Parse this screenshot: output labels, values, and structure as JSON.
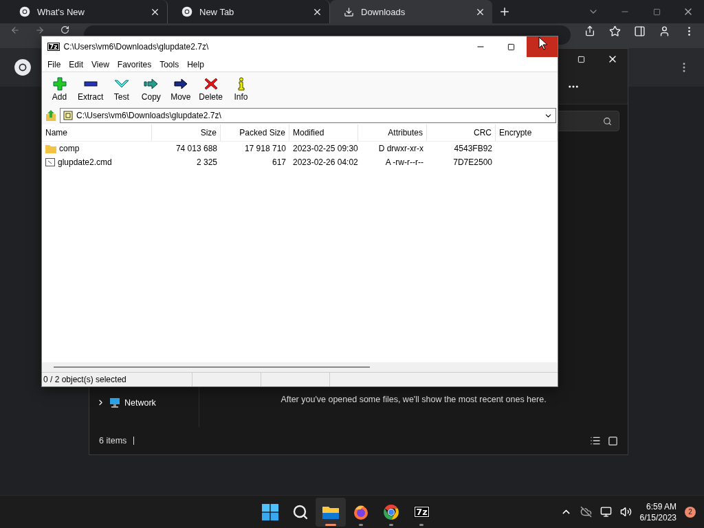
{
  "browser": {
    "tabs": [
      {
        "title": "What's New",
        "kind": "page",
        "selected": false
      },
      {
        "title": "New Tab",
        "kind": "page",
        "selected": false
      },
      {
        "title": "Downloads",
        "kind": "downloads",
        "selected": true
      }
    ]
  },
  "explorer": {
    "nav_items": [
      {
        "label": "Network",
        "expanded": false
      }
    ],
    "message": "After you've opened some files, we'll show the most recent ones here.",
    "status": "6 items"
  },
  "archive_window": {
    "icon_text": "7z",
    "title": "C:\\Users\\vm6\\Downloads\\glupdate2.7z\\",
    "menu": [
      "File",
      "Edit",
      "View",
      "Favorites",
      "Tools",
      "Help"
    ],
    "toolbar": [
      {
        "label": "Add",
        "kind": "add"
      },
      {
        "label": "Extract",
        "kind": "extract"
      },
      {
        "label": "Test",
        "kind": "test"
      },
      {
        "label": "Copy",
        "kind": "copy"
      },
      {
        "label": "Move",
        "kind": "move"
      },
      {
        "label": "Delete",
        "kind": "delete"
      },
      {
        "label": "Info",
        "kind": "info"
      }
    ],
    "path": "C:\\Users\\vm6\\Downloads\\glupdate2.7z\\",
    "columns": [
      "Name",
      "Size",
      "Packed Size",
      "Modified",
      "Attributes",
      "CRC",
      "Encrypte"
    ],
    "rows": [
      {
        "kind": "folder",
        "cells": [
          "comp",
          "74 013 688",
          "17 918 710",
          "2023-02-25 09:30",
          "D drwxr-xr-x",
          "4543FB92"
        ]
      },
      {
        "kind": "file",
        "cells": [
          "glupdate2.cmd",
          "2 325",
          "617",
          "2023-02-26 04:02",
          "A -rw-r--r--",
          "7D7E2500"
        ]
      }
    ],
    "status": "0 / 2 object(s) selected"
  },
  "taskbar": {
    "apps": [
      {
        "kind": "start",
        "selected": false,
        "running": false
      },
      {
        "kind": "search",
        "selected": false,
        "running": false
      },
      {
        "kind": "files",
        "selected": true,
        "running": true
      },
      {
        "kind": "firefox",
        "selected": false,
        "running": true
      },
      {
        "kind": "chrome",
        "selected": false,
        "running": true
      },
      {
        "kind": "archiver",
        "label": "7z",
        "selected": false,
        "running": true
      }
    ],
    "time": "6:59 AM",
    "date": "6/15/2023",
    "notifications": "2"
  }
}
